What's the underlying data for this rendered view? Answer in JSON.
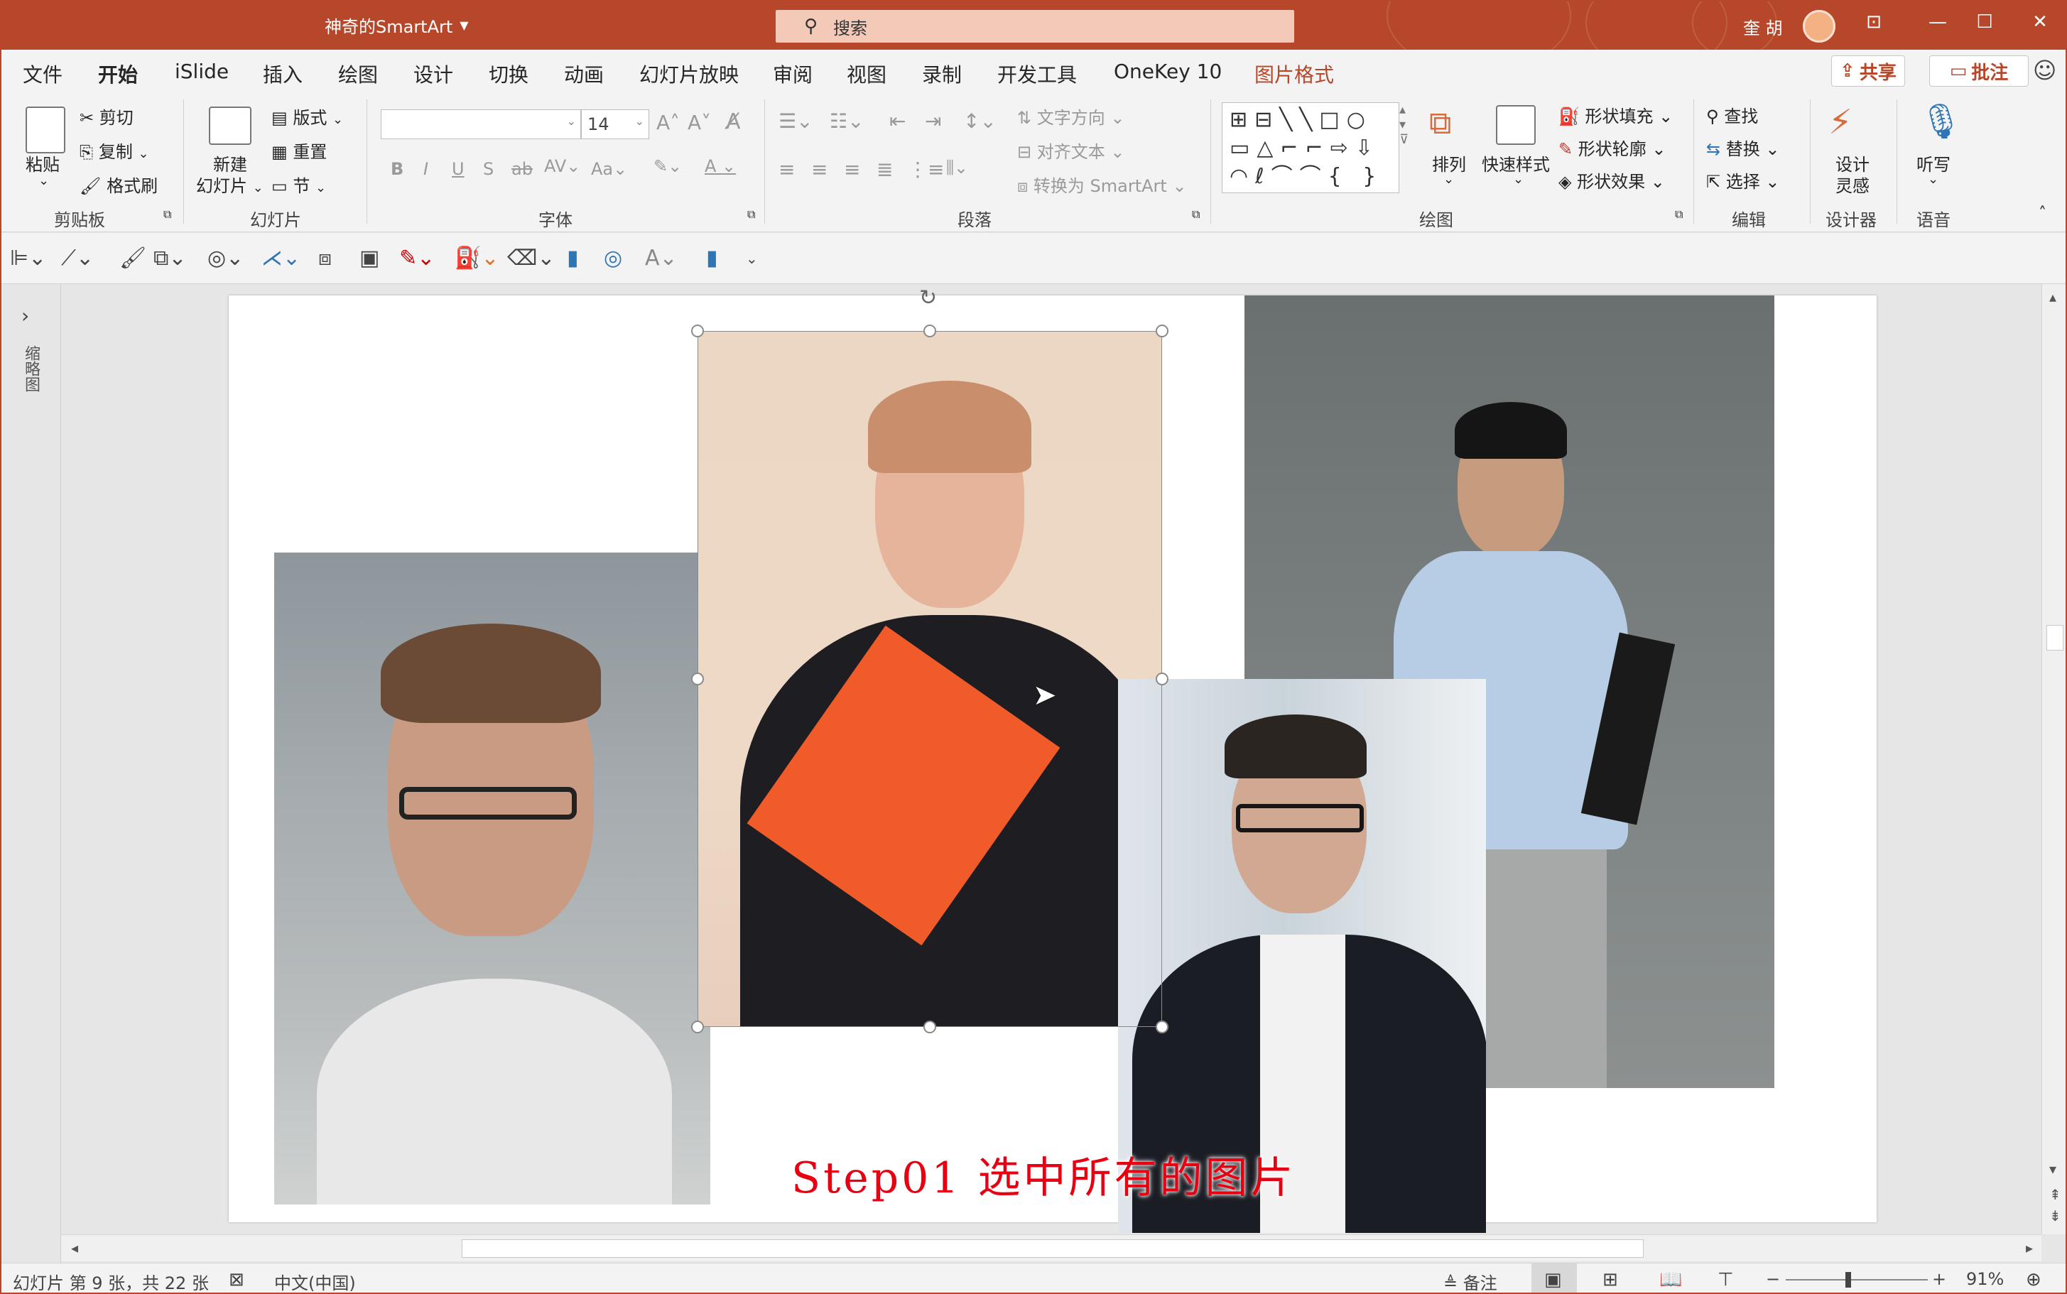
{
  "app": {
    "title": "神奇的SmartArt",
    "search_placeholder": "搜索",
    "user": "奎 胡"
  },
  "menu": {
    "tabs": [
      "文件",
      "开始",
      "iSlide",
      "插入",
      "绘图",
      "设计",
      "切换",
      "动画",
      "幻灯片放映",
      "审阅",
      "视图",
      "录制",
      "开发工具",
      "OneKey 10",
      "图片格式"
    ],
    "active": "开始",
    "share": "共享",
    "comment": "批注"
  },
  "ribbon": {
    "clipboard": {
      "paste": "粘贴",
      "cut": "剪切",
      "copy": "复制",
      "format_painter": "格式刷",
      "label": "剪贴板"
    },
    "slides": {
      "new_slide_line1": "新建",
      "new_slide_line2": "幻灯片",
      "layout": "版式",
      "reset": "重置",
      "section": "节",
      "label": "幻灯片"
    },
    "font": {
      "font_size": "14",
      "label": "字体"
    },
    "paragraph": {
      "text_direction": "文字方向",
      "align_text": "对齐文本",
      "convert_smartart": "转换为 SmartArt",
      "label": "段落"
    },
    "drawing": {
      "arrange": "排列",
      "quick_styles": "快速样式",
      "shape_fill": "形状填充",
      "shape_outline": "形状轮廓",
      "shape_effects": "形状效果",
      "label": "绘图"
    },
    "editing": {
      "find": "查找",
      "replace": "替换",
      "select": "选择",
      "label": "编辑"
    },
    "designer": {
      "ideas_line1": "设计",
      "ideas_line2": "灵感",
      "label": "设计器"
    },
    "voice": {
      "dictate": "听写",
      "label": "语音"
    }
  },
  "left_pane": {
    "label": "缩略图"
  },
  "slide": {
    "caption": "Step01 选中所有的图片"
  },
  "status": {
    "slide_info": "幻灯片 第 9 张，共 22 张",
    "language": "中文(中国)",
    "notes": "备注",
    "zoom": "91%"
  },
  "colors": {
    "accent": "#b7472a",
    "caption": "#e60012"
  }
}
